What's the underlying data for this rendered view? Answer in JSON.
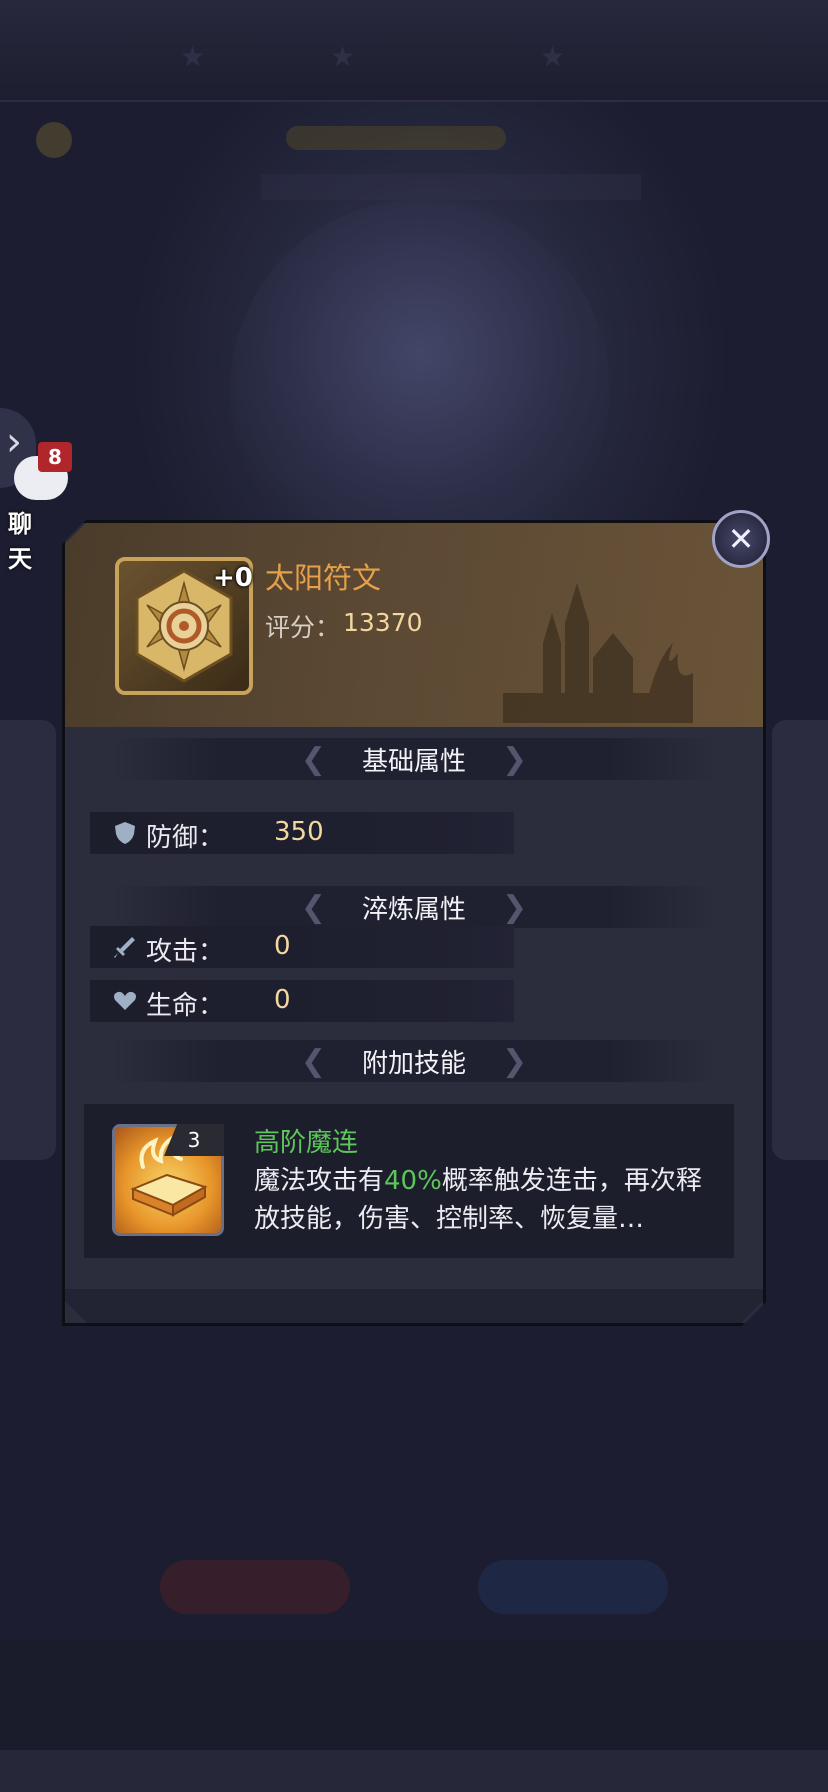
{
  "chat": {
    "label": "聊 天",
    "badge_count": "8"
  },
  "item": {
    "name": "太阳符文",
    "enhance_level": "+0",
    "score_label": "评分：",
    "score_value": "13370"
  },
  "sections": {
    "base": "基础属性",
    "refine": "淬炼属性",
    "skill": "附加技能"
  },
  "stats": {
    "defense": {
      "label": "防御：",
      "value": "350",
      "icon": "shield-icon"
    },
    "attack": {
      "label": "攻击：",
      "value": "0",
      "icon": "sword-icon"
    },
    "hp": {
      "label": "生命：",
      "value": "0",
      "icon": "heart-icon"
    }
  },
  "skill": {
    "level": "3",
    "name": "高阶魔连",
    "desc_prefix": "魔法攻击有",
    "desc_highlight": "40%",
    "desc_suffix": "概率触发连击，再次释放技能，伤害、控制率、恢复量…"
  },
  "colors": {
    "item_name": "#e6a04a",
    "value": "#f2d7a0",
    "skill_green": "#5cc65a",
    "badge_red": "#b0262a"
  }
}
